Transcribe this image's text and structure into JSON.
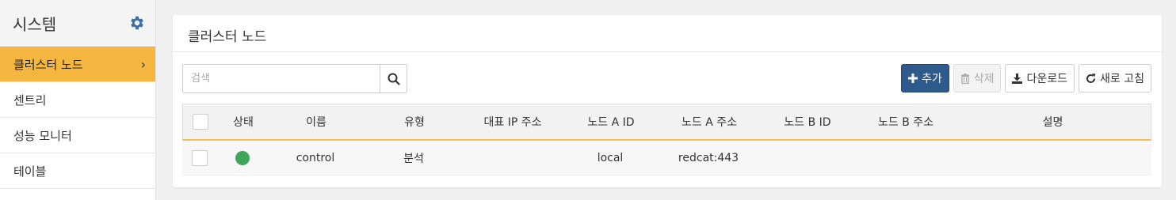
{
  "sidebar": {
    "title": "시스템",
    "items": [
      {
        "label": "클러스터 노드",
        "active": true
      },
      {
        "label": "센트리"
      },
      {
        "label": "성능 모니터"
      },
      {
        "label": "테이블"
      }
    ]
  },
  "panel": {
    "title": "클러스터 노드",
    "search": {
      "placeholder": "검색"
    },
    "buttons": {
      "add": "추가",
      "delete": "삭제",
      "download": "다운로드",
      "refresh": "새로 고침"
    }
  },
  "table": {
    "headers": [
      "상태",
      "이름",
      "유형",
      "대표 IP 주소",
      "노드 A ID",
      "노드 A 주소",
      "노드 B ID",
      "노드 B 주소",
      "설명"
    ],
    "rows": [
      {
        "status": "online",
        "name": "control",
        "type": "분석",
        "ip": "",
        "node_a_id": "local",
        "node_a_addr": "redcat:443",
        "node_b_id": "",
        "node_b_addr": "",
        "desc": ""
      }
    ]
  },
  "colors": {
    "accent": "#f4b63f",
    "primary": "#2e5a8c",
    "status_ok": "#3fa65a",
    "icon": "#3b6ea5"
  },
  "icons": {
    "gear": "gear-icon",
    "search": "search-icon",
    "plus": "plus-icon",
    "trash": "trash-icon",
    "download": "download-icon",
    "refresh": "refresh-icon",
    "chevron": "chevron-right-icon"
  }
}
